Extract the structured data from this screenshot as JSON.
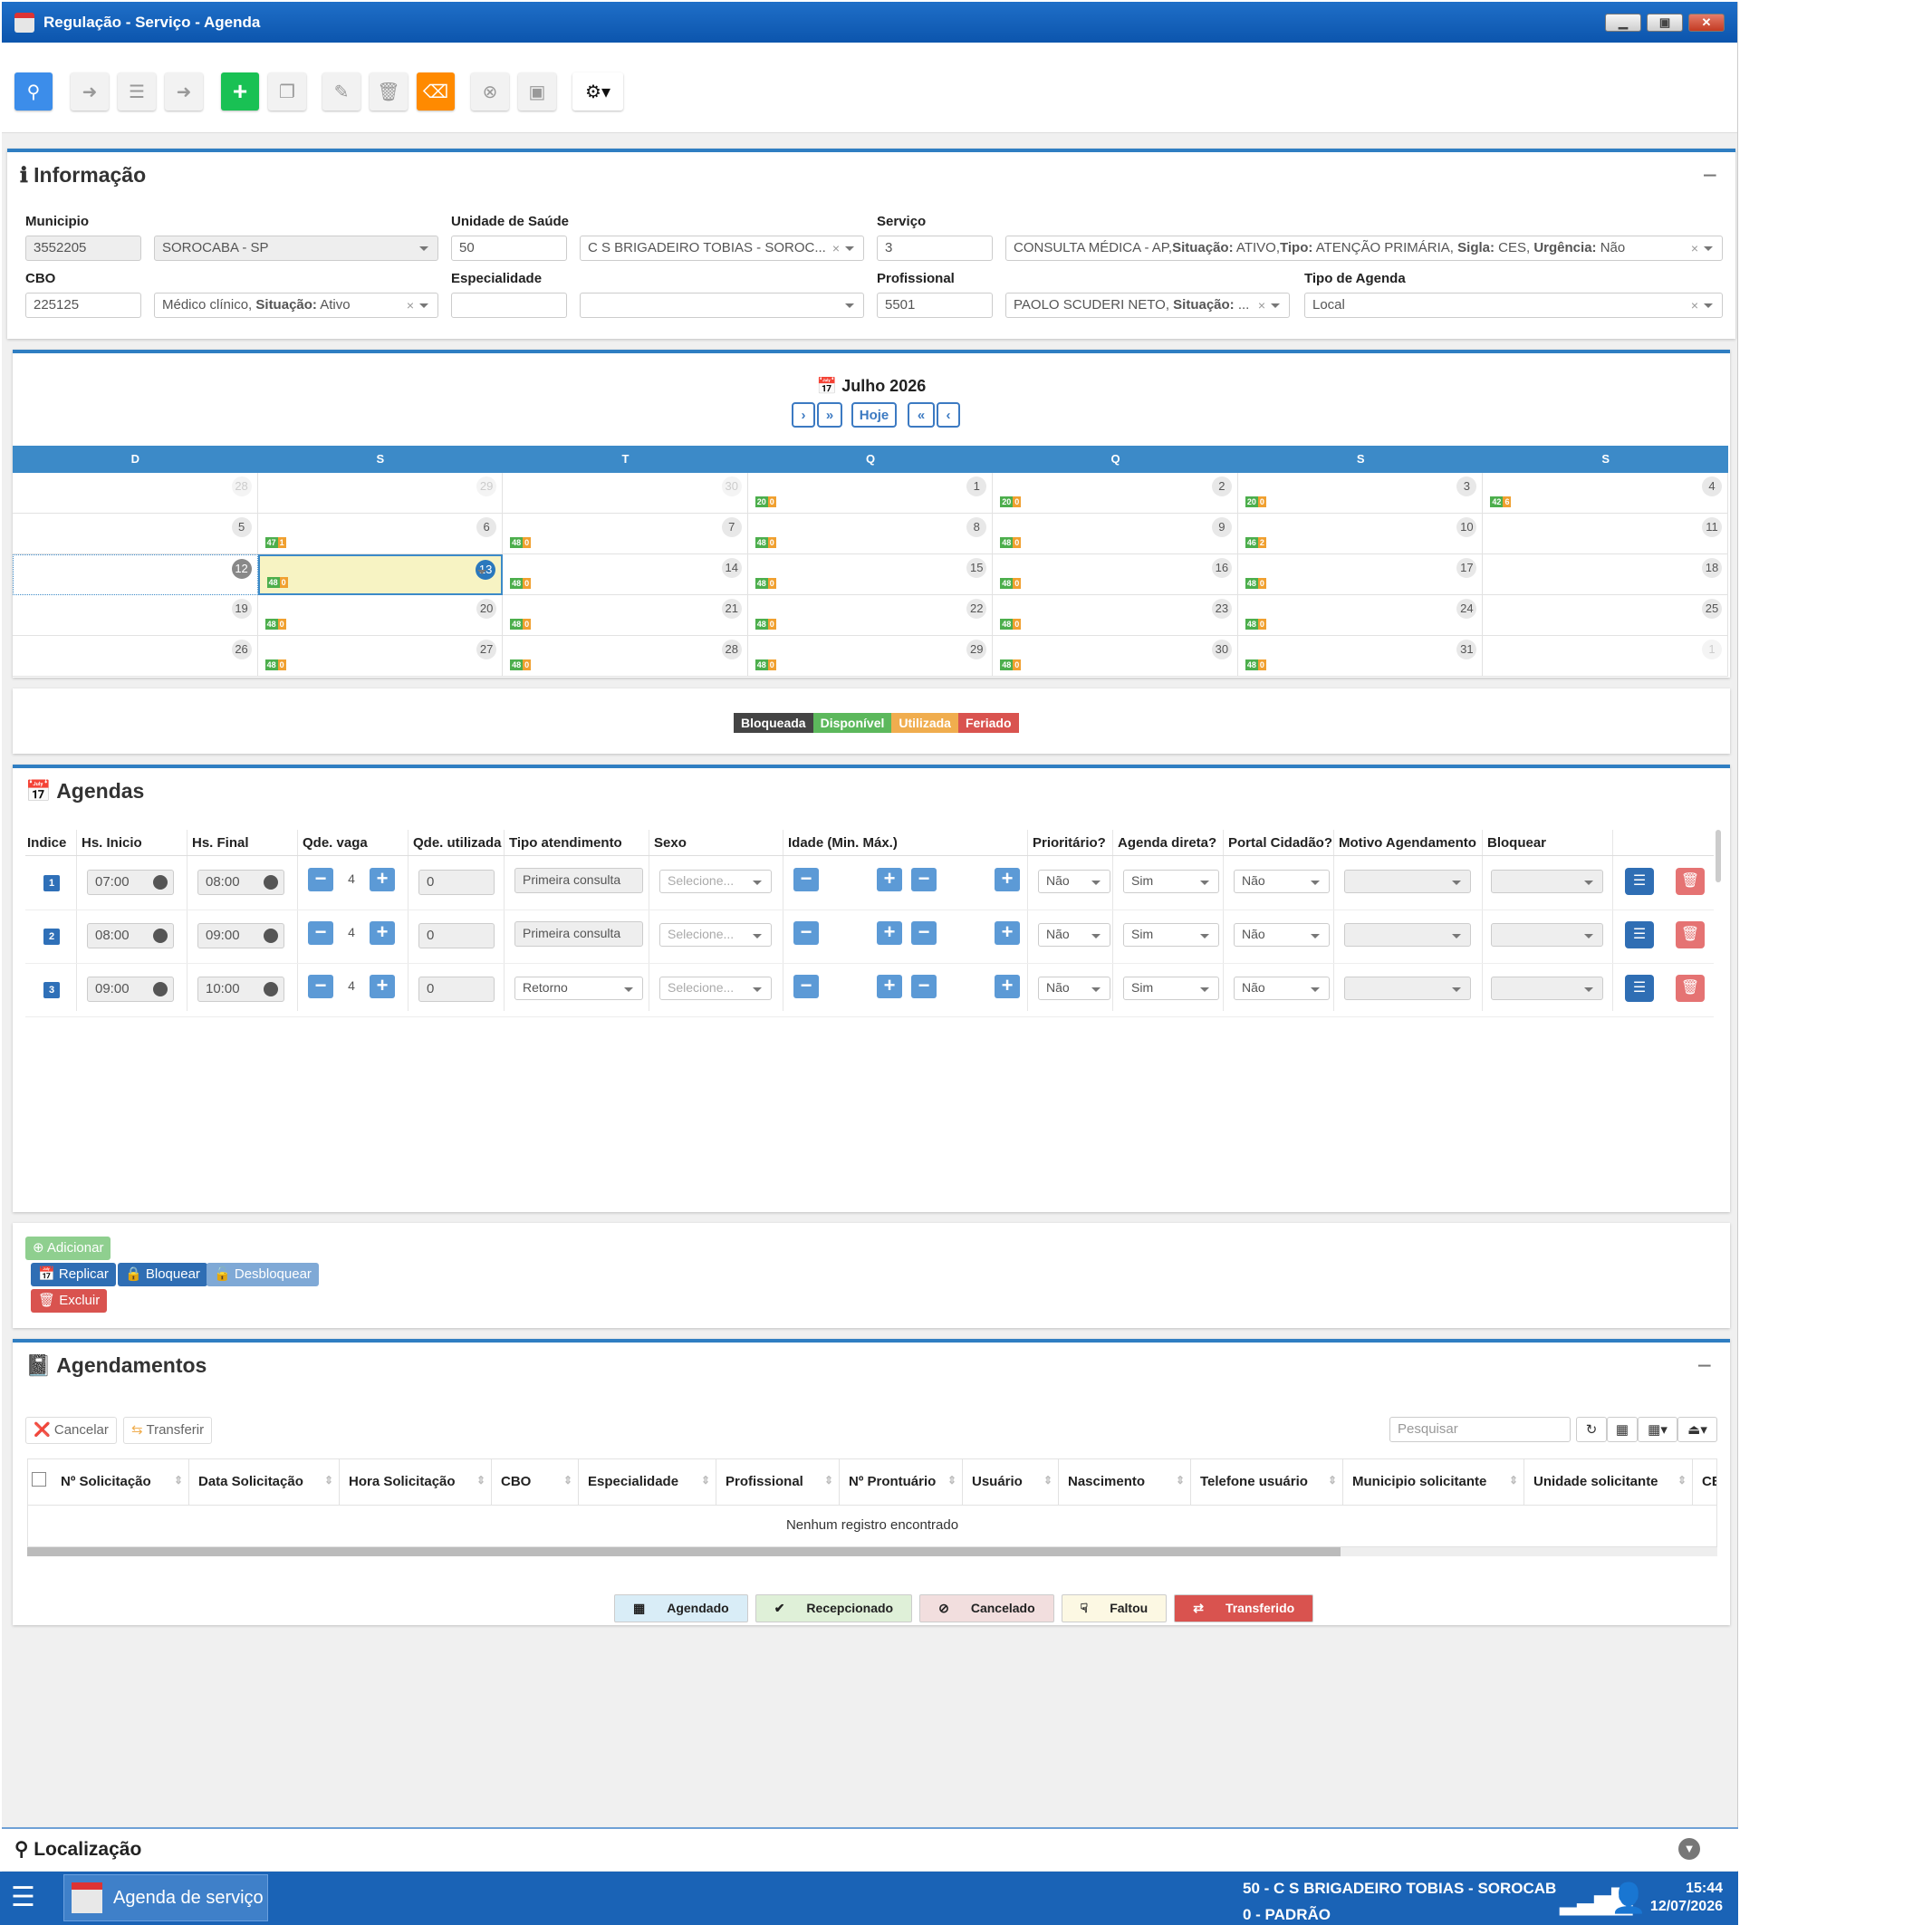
{
  "window": {
    "title": "Regulação - Serviço - Agenda"
  },
  "info": {
    "title": "Informação",
    "municipio": {
      "label": "Municipio",
      "code": "3552205",
      "name": "SOROCABA - SP"
    },
    "unidade": {
      "label": "Unidade de Saúde",
      "code": "50",
      "name": "C S BRIGADEIRO TOBIAS - SOROC..."
    },
    "servico": {
      "label": "Serviço",
      "code": "3",
      "name": "CONSULTA MÉDICA - AP,",
      "situacao_label": "Situação:",
      "situacao": "ATIVO,",
      "tipo_label": "Tipo:",
      "tipo": "ATENÇÃO PRIMÁRIA,",
      "sigla_label": "Sigla:",
      "sigla": "CES,",
      "urgencia_label": "Urgência:",
      "urgencia": "Não"
    },
    "cbo": {
      "label": "CBO",
      "code": "225125",
      "name": "Médico clínico,",
      "situacao_label": "Situação:",
      "situacao": "Ativo"
    },
    "especialidade": {
      "label": "Especialidade",
      "code": "",
      "name": ""
    },
    "profissional": {
      "label": "Profissional",
      "code": "5501",
      "name": "PAOLO SCUDERI NETO,",
      "situacao_label": "Situação:",
      "situacao": "..."
    },
    "tipo_agenda": {
      "label": "Tipo de Agenda",
      "value": "Local"
    }
  },
  "calendar": {
    "title": "Julho 2026",
    "nav": {
      "next": "›",
      "next_year": "»",
      "today": "Hoje",
      "prev_year": "«",
      "prev": "‹"
    },
    "weekdays": [
      "D",
      "S",
      "T",
      "Q",
      "Q",
      "S",
      "S"
    ],
    "weeks": [
      [
        {
          "d": "28",
          "o": true
        },
        {
          "d": "29",
          "o": true
        },
        {
          "d": "30",
          "o": true
        },
        {
          "d": "1",
          "a": "20",
          "u": "0"
        },
        {
          "d": "2",
          "a": "20",
          "u": "0"
        },
        {
          "d": "3",
          "a": "20",
          "u": "0"
        },
        {
          "d": "4",
          "a": "42",
          "u": "6"
        }
      ],
      [
        {
          "d": "5"
        },
        {
          "d": "6",
          "a": "47",
          "u": "1"
        },
        {
          "d": "7",
          "a": "48",
          "u": "0"
        },
        {
          "d": "8",
          "a": "48",
          "u": "0"
        },
        {
          "d": "9",
          "a": "48",
          "u": "0"
        },
        {
          "d": "10",
          "a": "46",
          "u": "2"
        },
        {
          "d": "11"
        }
      ],
      [
        {
          "d": "12",
          "today": true
        },
        {
          "d": "13",
          "sel": true,
          "a": "48",
          "u": "0"
        },
        {
          "d": "14",
          "a": "48",
          "u": "0"
        },
        {
          "d": "15",
          "a": "48",
          "u": "0"
        },
        {
          "d": "16",
          "a": "48",
          "u": "0"
        },
        {
          "d": "17",
          "a": "48",
          "u": "0"
        },
        {
          "d": "18"
        }
      ],
      [
        {
          "d": "19"
        },
        {
          "d": "20",
          "a": "48",
          "u": "0"
        },
        {
          "d": "21",
          "a": "48",
          "u": "0"
        },
        {
          "d": "22",
          "a": "48",
          "u": "0"
        },
        {
          "d": "23",
          "a": "48",
          "u": "0"
        },
        {
          "d": "24",
          "a": "48",
          "u": "0"
        },
        {
          "d": "25"
        }
      ],
      [
        {
          "d": "26"
        },
        {
          "d": "27",
          "a": "48",
          "u": "0"
        },
        {
          "d": "28",
          "a": "48",
          "u": "0"
        },
        {
          "d": "29",
          "a": "48",
          "u": "0"
        },
        {
          "d": "30",
          "a": "48",
          "u": "0"
        },
        {
          "d": "31",
          "a": "48",
          "u": "0"
        },
        {
          "d": "1",
          "o": true
        }
      ]
    ],
    "legend": [
      {
        "label": "Bloqueada",
        "color": "#444444"
      },
      {
        "label": "Disponível",
        "color": "#5cb85c"
      },
      {
        "label": "Utilizada",
        "color": "#f0ad4e"
      },
      {
        "label": "Feriado",
        "color": "#d9534f"
      }
    ]
  },
  "agendas": {
    "title": "Agendas",
    "headers": [
      "Indice",
      "Hs. Inicio",
      "Hs. Final",
      "Qde. vaga",
      "Qde. utilizada",
      "Tipo atendimento",
      "Sexo",
      "Idade (Min. Máx.)",
      "Prioritário?",
      "Agenda direta?",
      "Portal Cidadão?",
      "Motivo Agendamento",
      "Bloquear"
    ],
    "rows": [
      {
        "index": "1",
        "start": "07:00",
        "end": "08:00",
        "vagas": "4",
        "utilizada": "0",
        "tipo": "Primeira consulta",
        "tipo_select": false,
        "sexo": "Selecione...",
        "prioritario": "Não",
        "direta": "Sim",
        "portal": "Não"
      },
      {
        "index": "2",
        "start": "08:00",
        "end": "09:00",
        "vagas": "4",
        "utilizada": "0",
        "tipo": "Primeira consulta",
        "tipo_select": false,
        "sexo": "Selecione...",
        "prioritario": "Não",
        "direta": "Sim",
        "portal": "Não"
      },
      {
        "index": "3",
        "start": "09:00",
        "end": "10:00",
        "vagas": "4",
        "utilizada": "0",
        "tipo": "Retorno",
        "tipo_select": true,
        "sexo": "Selecione...",
        "prioritario": "Não",
        "direta": "Sim",
        "portal": "Não"
      }
    ],
    "buttons": {
      "adicionar": "Adicionar",
      "replicar": "Replicar",
      "bloquear": "Bloquear",
      "desbloquear": "Desbloquear",
      "excluir": "Excluir"
    }
  },
  "agendamentos": {
    "title": "Agendamentos",
    "cancelar": "Cancelar",
    "transferir": "Transferir",
    "search_placeholder": "Pesquisar",
    "columns": [
      "Nº Solicitação",
      "Data Solicitação",
      "Hora Solicitação",
      "CBO",
      "Especialidade",
      "Profissional",
      "Nº Prontuário",
      "Usuário",
      "Nascimento",
      "Telefone usuário",
      "Municipio solicitante",
      "Unidade solicitante",
      "CB"
    ],
    "empty": "Nenhum registro encontrado",
    "status": [
      {
        "label": "Agendado",
        "bg": "#d9edf7",
        "fg": "#222222",
        "icon": "calendar-icon"
      },
      {
        "label": "Recepcionado",
        "bg": "#dff0d8",
        "fg": "#222222",
        "icon": "check-icon"
      },
      {
        "label": "Cancelado",
        "bg": "#f2dede",
        "fg": "#222222",
        "icon": "ban-icon"
      },
      {
        "label": "Faltou",
        "bg": "#fcf8e3",
        "fg": "#222222",
        "icon": "thumbs-down-icon"
      },
      {
        "label": "Transferido",
        "bg": "#d9534f",
        "fg": "#ffffff",
        "icon": "transfer-icon"
      }
    ]
  },
  "localizacao": {
    "title": "Localização"
  },
  "taskbar": {
    "app": "Agenda de serviço",
    "unit": "50 - C S BRIGADEIRO TOBIAS - SOROCAB",
    "profile": "0 - PADRÃO",
    "time": "15:44",
    "date": "12/07/2026"
  }
}
